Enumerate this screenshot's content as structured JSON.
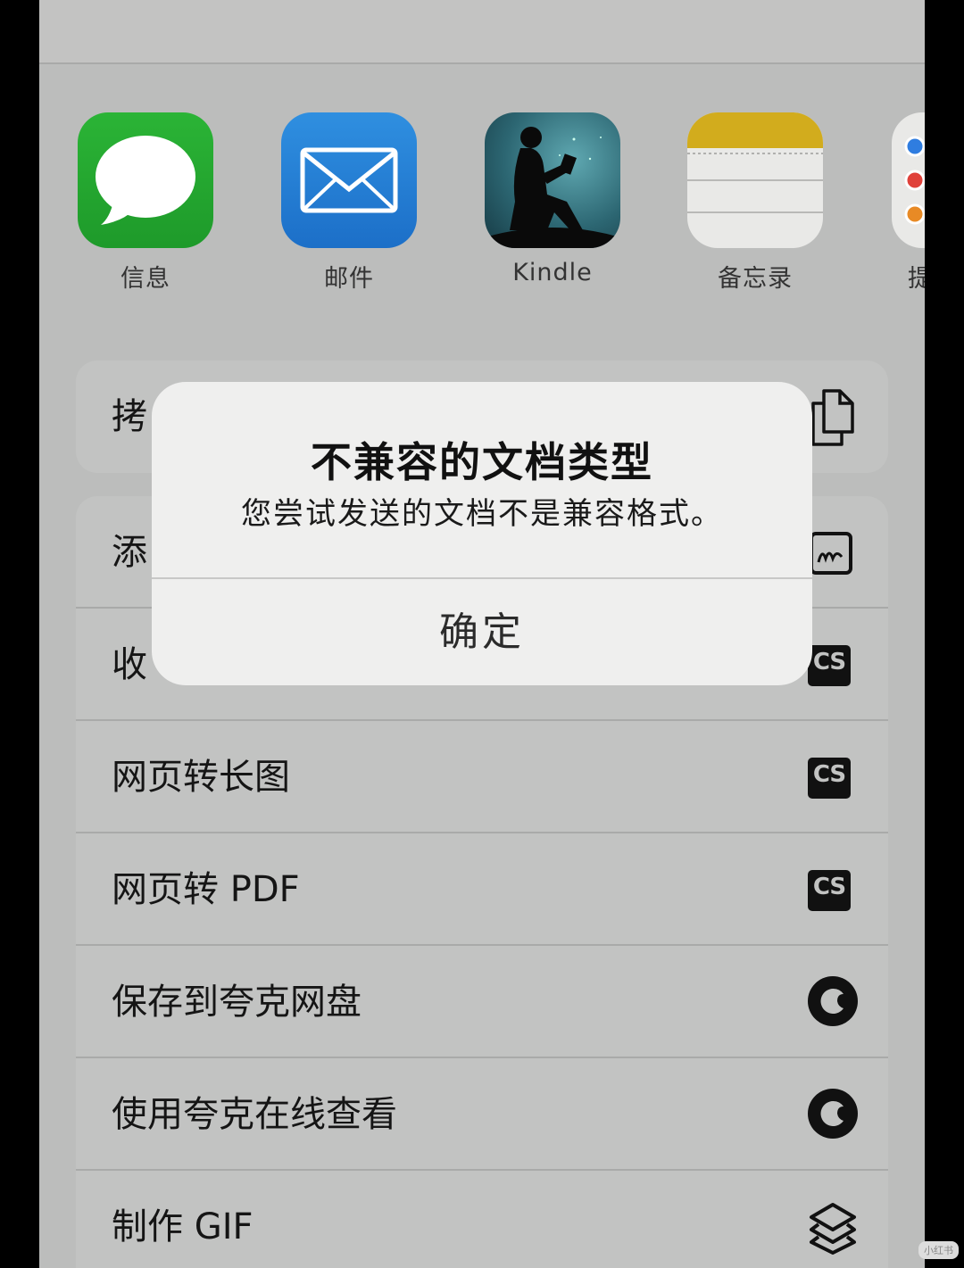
{
  "apps": [
    {
      "label": "信息",
      "icon": "messages-icon"
    },
    {
      "label": "邮件",
      "icon": "mail-icon"
    },
    {
      "label": "Kindle",
      "icon": "kindle-icon"
    },
    {
      "label": "备忘录",
      "icon": "notes-icon"
    },
    {
      "label": "提",
      "icon": "reminders-icon"
    }
  ],
  "group1": {
    "copy_label": "拷"
  },
  "group2": {
    "rows": [
      {
        "label": "添",
        "icon": "markup-icon"
      },
      {
        "label": "收",
        "icon": "camscanner-icon"
      },
      {
        "label": "网页转长图",
        "icon": "camscanner-icon"
      },
      {
        "label": "网页转 PDF",
        "icon": "camscanner-icon"
      },
      {
        "label": "保存到夸克网盘",
        "icon": "quark-icon"
      },
      {
        "label": "使用夸克在线查看",
        "icon": "quark-icon"
      },
      {
        "label": "制作 GIF",
        "icon": "shortcuts-icon"
      }
    ]
  },
  "cs_text": "CS",
  "alert": {
    "title": "不兼容的文档类型",
    "message": "您尝试发送的文档不是兼容格式。",
    "button": "确定"
  },
  "watermark": "小红书"
}
